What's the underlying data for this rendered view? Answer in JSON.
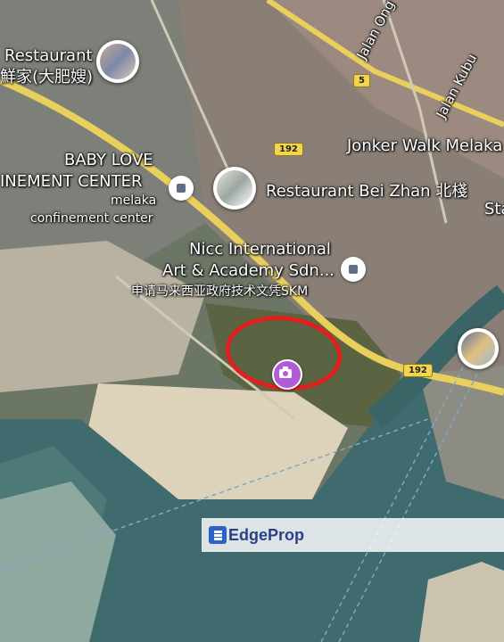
{
  "labels": {
    "restaurant_top": "Restaurant",
    "restaurant_top_sub": "鮮家(大肥嫂)",
    "baby_love_1": "BABY LOVE",
    "baby_love_2": "INEMENT CENTER",
    "melaka_conf_1": "melaka",
    "melaka_conf_2": "confinement center",
    "restaurant_bei": "Restaurant Bei Zhan 北棧",
    "nicc_1": "Nicc International",
    "nicc_2": "Art & Academy Sdn...",
    "skm": "申请马来西亚政府技术文凭SKM",
    "jonker": "Jonker Walk Melaka",
    "jalan_ong": "Jalan Ong",
    "jalan_kubu": "Jalan Kubu",
    "sta": "Sta"
  },
  "road_shields": {
    "r5": "5",
    "r192_top": "192",
    "r192_bottom": "192"
  },
  "watermark": {
    "brand": "EdgeProp"
  },
  "icons": {
    "camera": "camera-icon",
    "place_square": "place-square-icon",
    "photo_pin": "photo-pin-icon"
  },
  "colors": {
    "highlight_ring": "#e02020",
    "camera_pin": "#b15bd8",
    "road_yellow": "#f0d060",
    "water": "#3f6f72",
    "sand": "#e5dcc6"
  }
}
